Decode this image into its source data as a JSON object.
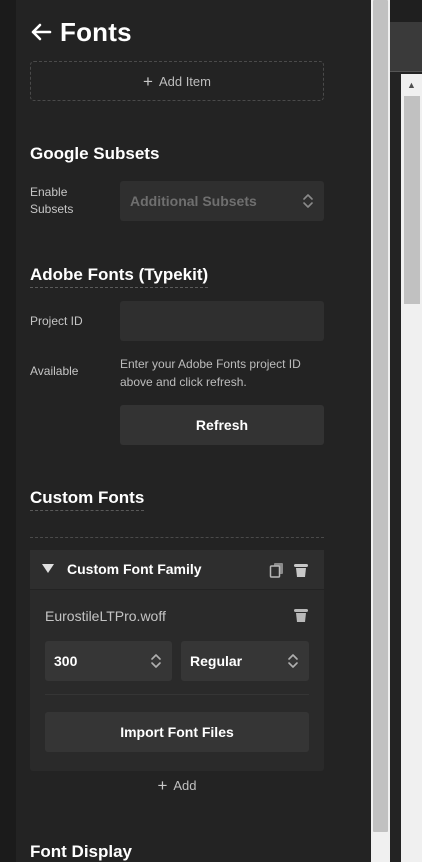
{
  "header": {
    "title": "Fonts",
    "back_icon": "arrow-left-icon"
  },
  "add_item": {
    "label": "Add Item"
  },
  "google_subsets": {
    "title": "Google Subsets",
    "label_line1": "Enable",
    "label_line2": "Subsets",
    "select_value": "Additional Subsets"
  },
  "adobe_fonts": {
    "title": "Adobe Fonts (Typekit)",
    "project_id_label": "Project ID",
    "project_id_value": "",
    "available_label": "Available",
    "help_text": "Enter your Adobe Fonts project ID above and click refresh.",
    "refresh_label": "Refresh"
  },
  "custom_fonts": {
    "title": "Custom Fonts",
    "family": {
      "title": "Custom Font Family",
      "file_name": "EurostileLTPro.woff",
      "weight": "300",
      "style": "Regular",
      "import_label": "Import Font Files"
    },
    "add_label": "Add"
  },
  "font_display": {
    "title": "Font Display"
  },
  "colors": {
    "panel_bg": "#232323",
    "field_bg": "#2f2f2f",
    "text": "#ffffff"
  }
}
